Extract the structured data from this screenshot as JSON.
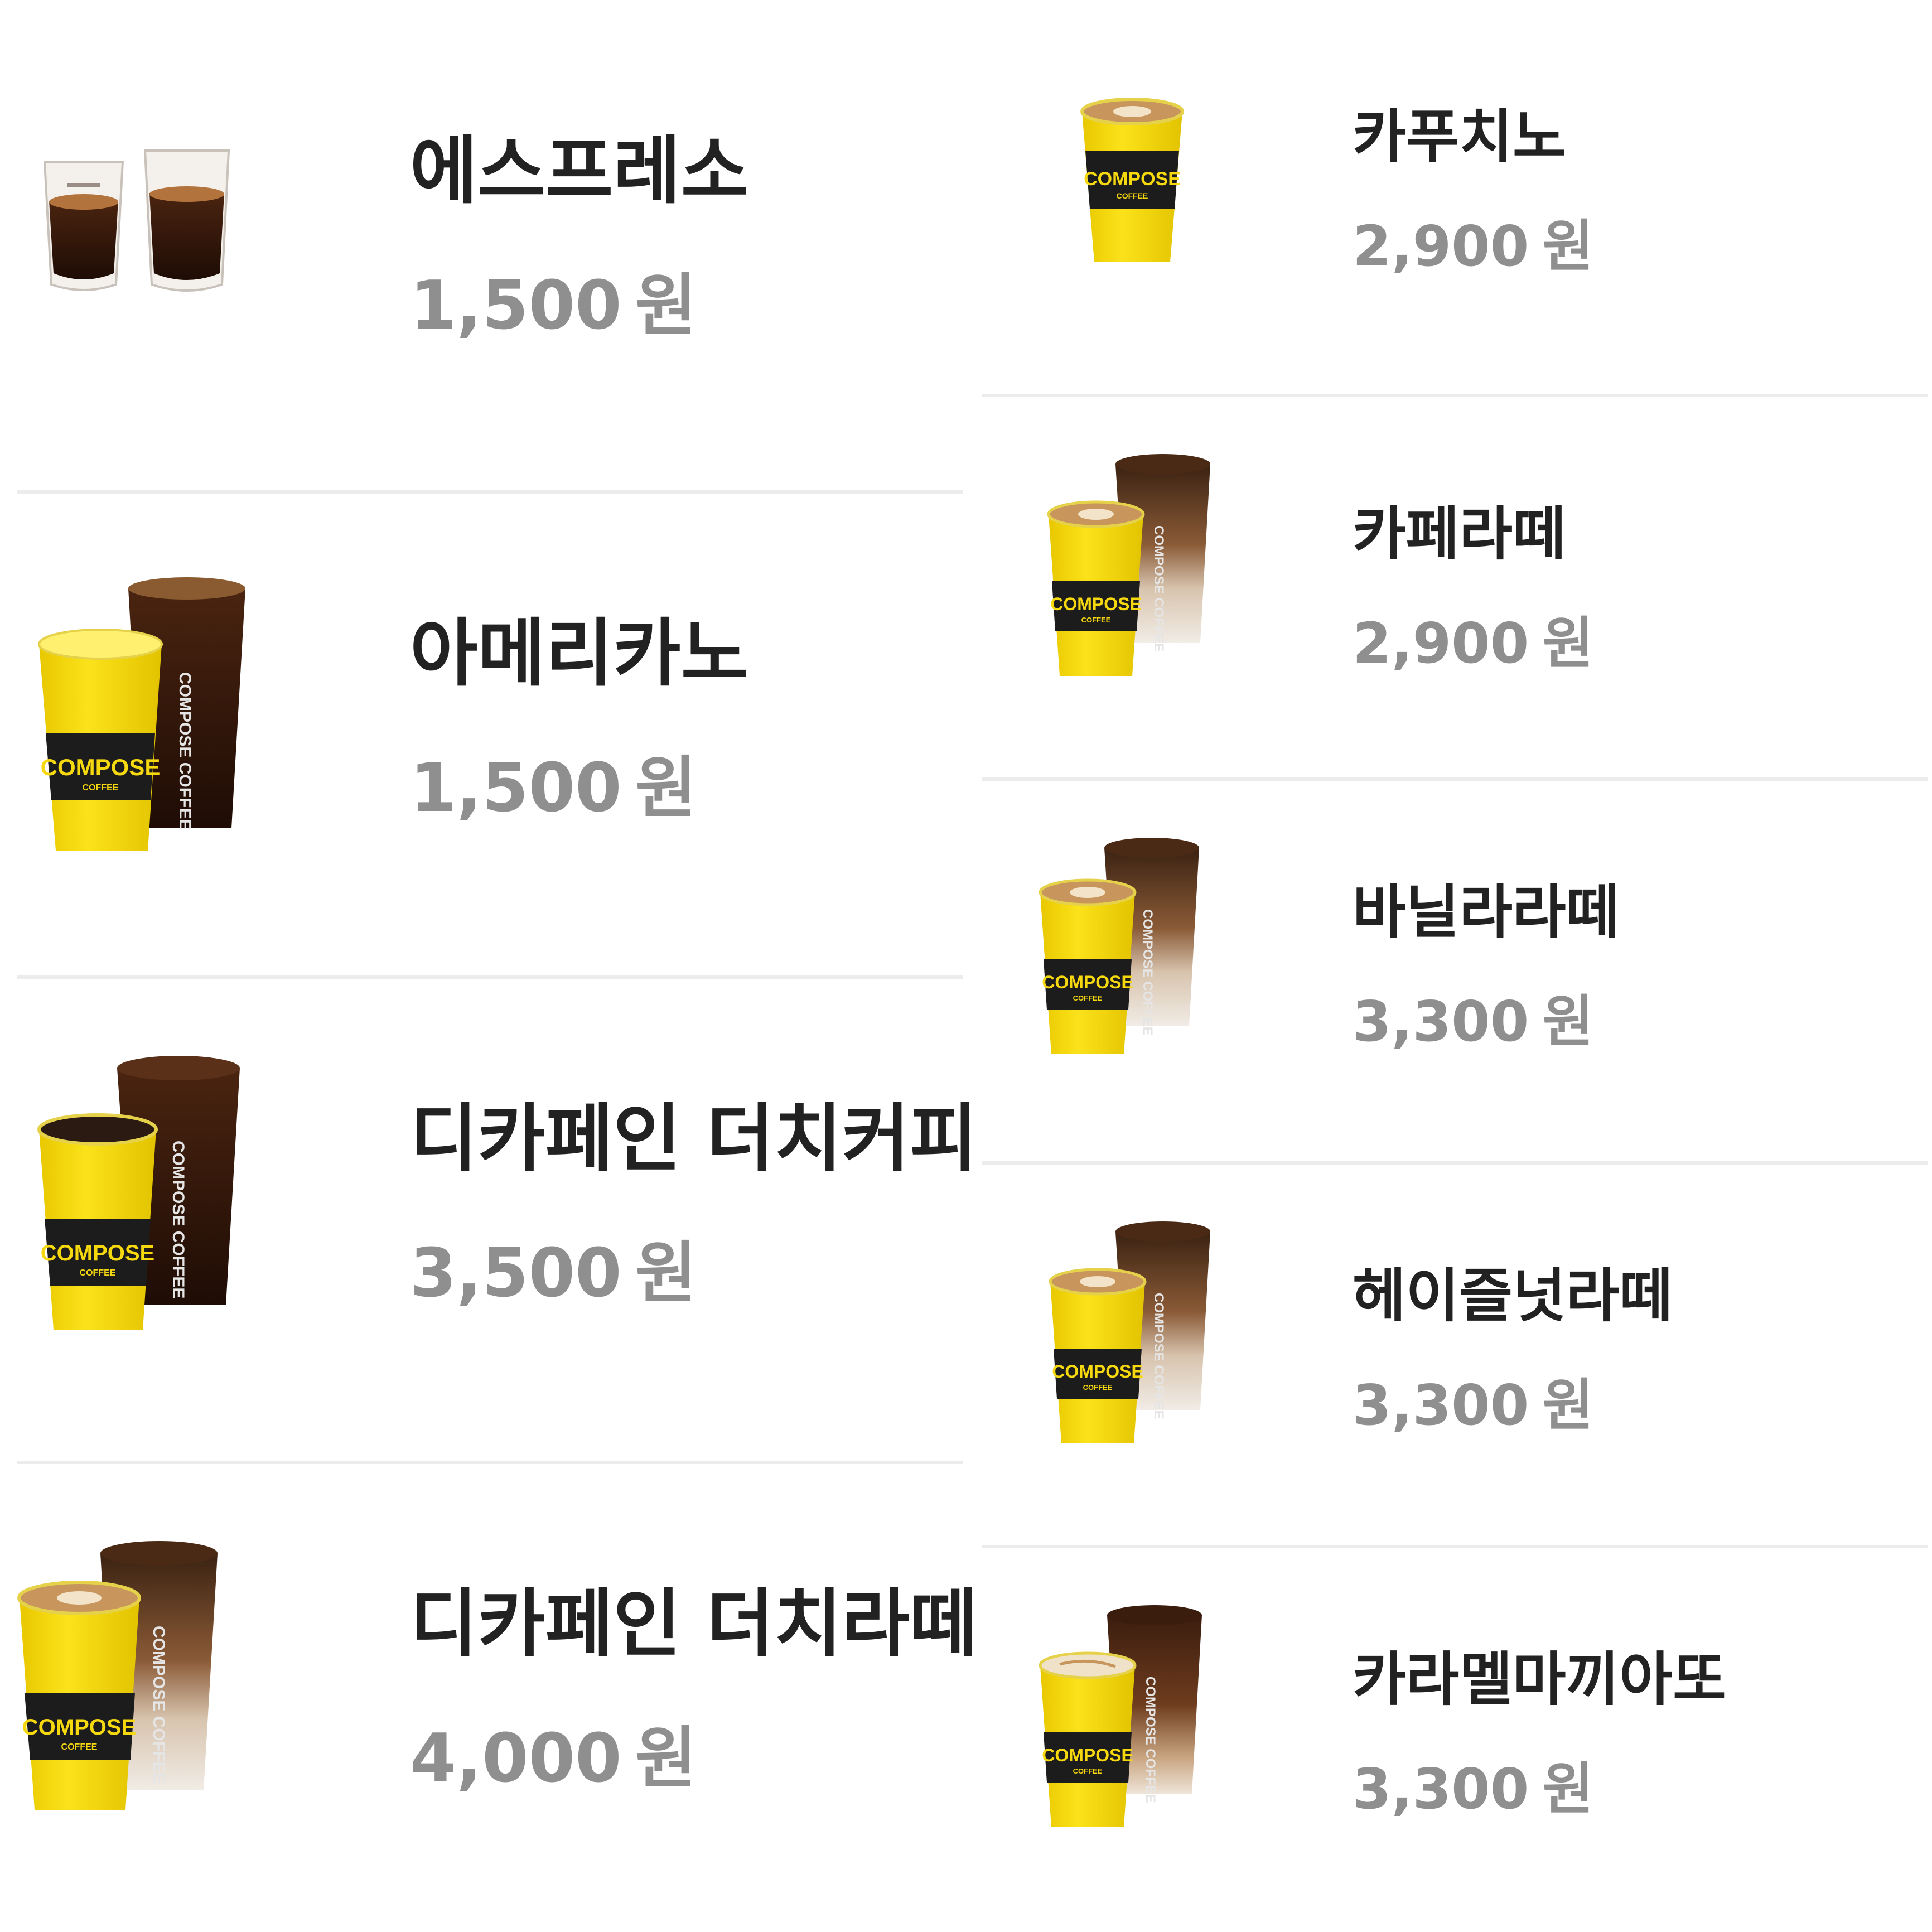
{
  "currency_unit": "원",
  "brand": {
    "name": "COMPOSE",
    "sub": "COFFEE"
  },
  "colors": {
    "cup_yellow": "#f6d80f",
    "sleeve": "#1c1c1c",
    "price_gray": "#8f8f8f",
    "name_dark": "#222222",
    "divider": "#ececec"
  },
  "left_menu": [
    {
      "name": "에스프레소",
      "price": "1,500",
      "image": "espresso-shots"
    },
    {
      "name": "아메리카노",
      "price": "1,500",
      "image": "hot-ice-americano"
    },
    {
      "name": "디카페인 더치커피",
      "price": "3,500",
      "image": "hot-ice-dutch-coffee"
    },
    {
      "name": "디카페인 더치라떼",
      "price": "4,000",
      "image": "hot-ice-dutch-latte"
    }
  ],
  "right_menu": [
    {
      "name": "카푸치노",
      "price": "2,900",
      "image": "cappuccino-cup"
    },
    {
      "name": "카페라떼",
      "price": "2,900",
      "image": "hot-ice-latte"
    },
    {
      "name": "바닐라라떼",
      "price": "3,300",
      "image": "hot-ice-vanilla-latte"
    },
    {
      "name": "헤이즐넛라떼",
      "price": "3,300",
      "image": "hot-ice-hazelnut-latte"
    },
    {
      "name": "카라멜마끼아또",
      "price": "3,300",
      "image": "hot-ice-caramel-macchiato"
    }
  ]
}
